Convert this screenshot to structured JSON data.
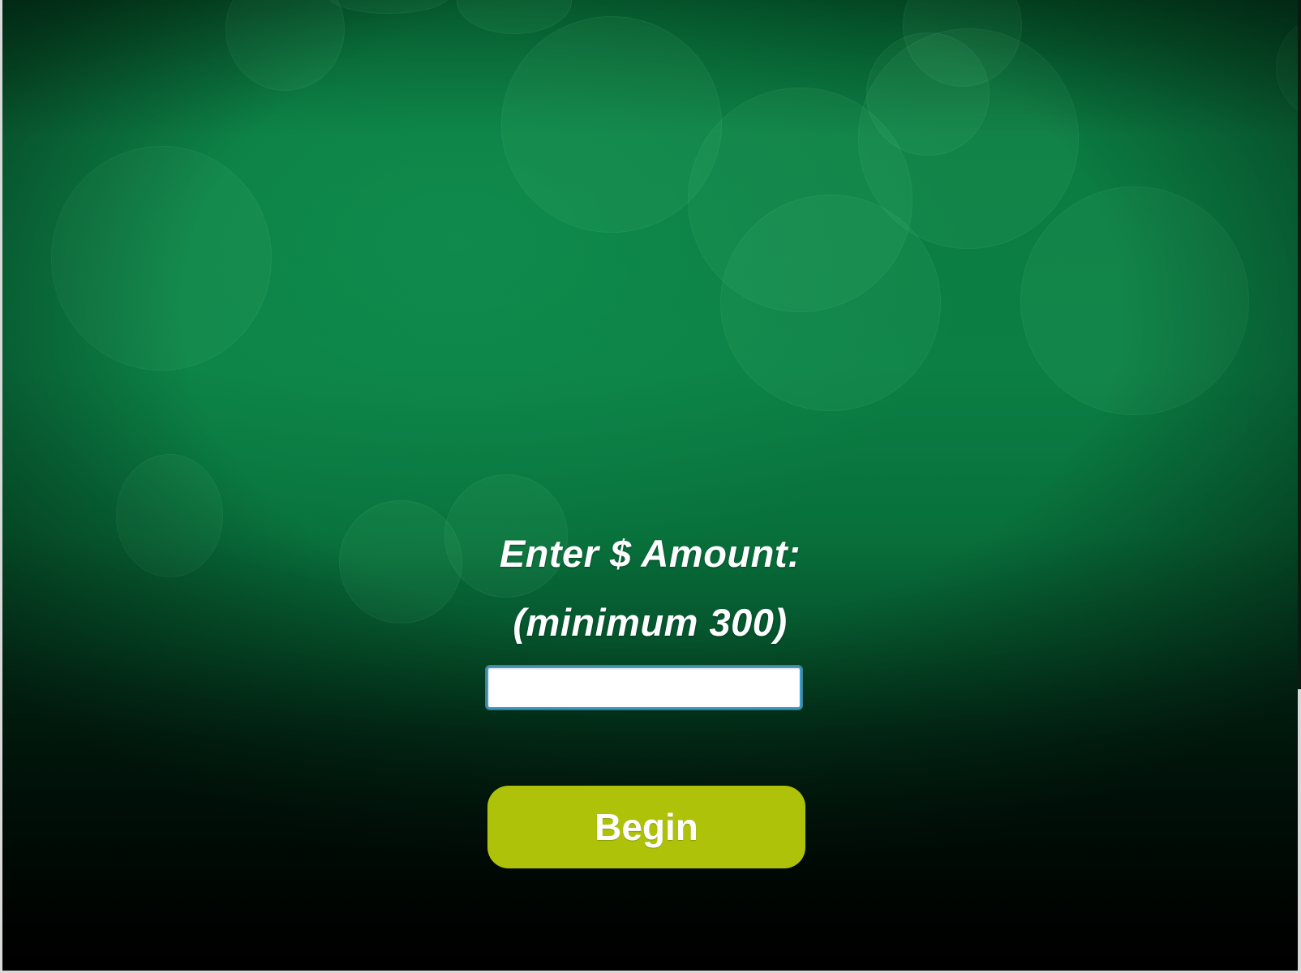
{
  "prompt": {
    "title": "Enter $ Amount:",
    "subtitle": "(minimum 300)"
  },
  "amount_input": {
    "value": "",
    "placeholder": ""
  },
  "begin_button": {
    "label": "Begin"
  },
  "colors": {
    "background_green": "#0b7f44",
    "background_dark": "#000000",
    "button": "#aec20a",
    "input_border": "#3a9fd6",
    "text": "#ffffff"
  }
}
